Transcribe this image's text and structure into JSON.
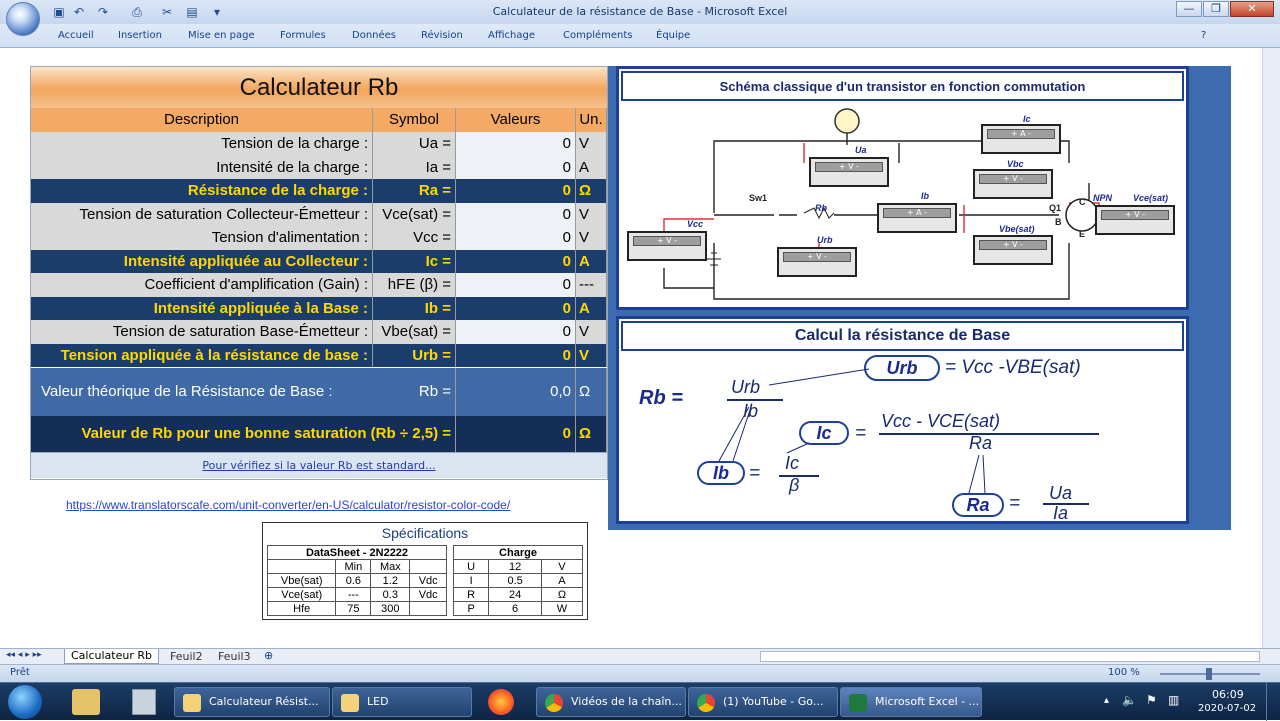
{
  "window": {
    "title": "Calculateur de la résistance de Base - Microsoft Excel",
    "minimize": "—",
    "restore": "❐",
    "close": "✕"
  },
  "ribbon_tabs": [
    "Accueil",
    "Insertion",
    "Mise en page",
    "Formules",
    "Données",
    "Révision",
    "Affichage",
    "Compléments",
    "Équipe"
  ],
  "calculator": {
    "title": "Calculateur Rb",
    "headers": {
      "description": "Description",
      "symbol": "Symbol",
      "value": "Valeurs",
      "unit": "Un."
    },
    "rows": [
      {
        "description": "Tension de la charge :",
        "symbol": "Ua =",
        "value": "0",
        "unit": "V",
        "style": "gray"
      },
      {
        "description": "Intensité de la charge :",
        "symbol": "Ia =",
        "value": "0",
        "unit": "A",
        "style": "gray"
      },
      {
        "description": "Résistance de la charge :",
        "symbol": "Ra =",
        "value": "0",
        "unit": "Ω",
        "style": "blue"
      },
      {
        "description": "Tension de saturation Collecteur-Émetteur :",
        "symbol": "Vce(sat) =",
        "value": "0",
        "unit": "V",
        "style": "gray"
      },
      {
        "description": "Tension d'alimentation :",
        "symbol": "Vcc =",
        "value": "0",
        "unit": "V",
        "style": "gray"
      },
      {
        "description": "Intensité appliquée au Collecteur :",
        "symbol": "Ic =",
        "value": "0",
        "unit": "A",
        "style": "blue"
      },
      {
        "description": "Coefficient d'amplification (Gain) :",
        "symbol": "hFE (β) =",
        "value": "0",
        "unit": "---",
        "style": "gray"
      },
      {
        "description": "Intensité appliquée à la Base :",
        "symbol": "Ib =",
        "value": "0",
        "unit": "A",
        "style": "blue"
      },
      {
        "description": "Tension de saturation Base-Émetteur :",
        "symbol": "Vbe(sat) =",
        "value": "0",
        "unit": "V",
        "style": "gray"
      },
      {
        "description": "Tension appliquée à la résistance de base :",
        "symbol": "Urb =",
        "value": "0",
        "unit": "V",
        "style": "blue"
      }
    ],
    "theoretical": {
      "description": "Valeur théorique de la Résistance de Base :",
      "symbol": "Rb =",
      "value": "0,0",
      "unit": "Ω"
    },
    "saturation": {
      "description": "Valeur de Rb pour une bonne saturation (Rb ÷ 2,5) =",
      "value": "0",
      "unit": "Ω"
    },
    "link": "Pour vérifiez si la valeur Rb est standard..."
  },
  "url": "https://www.translatorscafe.com/unit-converter/en-US/calculator/resistor-color-code/",
  "specs": {
    "title": "Spécifications",
    "datasheet": {
      "title": "DataSheet - 2N2222",
      "head": [
        "",
        "Min",
        "Max",
        ""
      ],
      "rows": [
        [
          "Vbe(sat)",
          "0.6",
          "1.2",
          "Vdc"
        ],
        [
          "Vce(sat)",
          "---",
          "0.3",
          "Vdc"
        ],
        [
          "Hfe",
          "75",
          "300",
          ""
        ]
      ]
    },
    "charge": {
      "title": "Charge",
      "rows": [
        [
          "U",
          "12",
          "V"
        ],
        [
          "I",
          "0.5",
          "A"
        ],
        [
          "R",
          "24",
          "Ω"
        ],
        [
          "P",
          "6",
          "W"
        ]
      ]
    }
  },
  "schematic": {
    "title": "Schéma classique d'un transistor en fonction commutation",
    "labels": {
      "ua": "Ua",
      "ic": "Ic",
      "vbc": "Vbc",
      "ib": "Ib",
      "vcc": "Vcc",
      "sw1": "Sw1",
      "rb": "Rb",
      "urb": "Urb",
      "vbe": "Vbe(sat)",
      "vce": "Vce(sat)",
      "npn": "NPN",
      "q1": "Q1",
      "c": "C",
      "b": "B",
      "e": "E"
    },
    "meter_text": "+   V   -",
    "meter_text_a": "+   A   -"
  },
  "formula": {
    "title": "Calcul la résistance de Base",
    "rb": "Rb =",
    "rb_num": "Urb",
    "rb_den": "Ib",
    "urb": "Urb",
    "urb_eq": "= Vcc -VBE(sat)",
    "ic": "Ic",
    "ic_eq": "=",
    "ic_num": "Vcc - VCE(sat)",
    "ic_den": "Ra",
    "ib": "Ib",
    "ib_eq": "=",
    "ib_num": "Ic",
    "ib_den": "β",
    "ra": "Ra",
    "ra_eq": "=",
    "ra_num": "Ua",
    "ra_den": "Ia"
  },
  "sheet_tabs": [
    "Calculateur Rb",
    "Feuil2",
    "Feuil3"
  ],
  "status": {
    "ready": "Prêt",
    "zoom": "100 %"
  },
  "taskbar": {
    "items": [
      "Calculateur Résist...",
      "LED",
      "Vidéos de la chaîn...",
      "(1) YouTube - Go...",
      "Microsoft Excel - ..."
    ],
    "time": "06:09",
    "date": "2020-07-02"
  }
}
